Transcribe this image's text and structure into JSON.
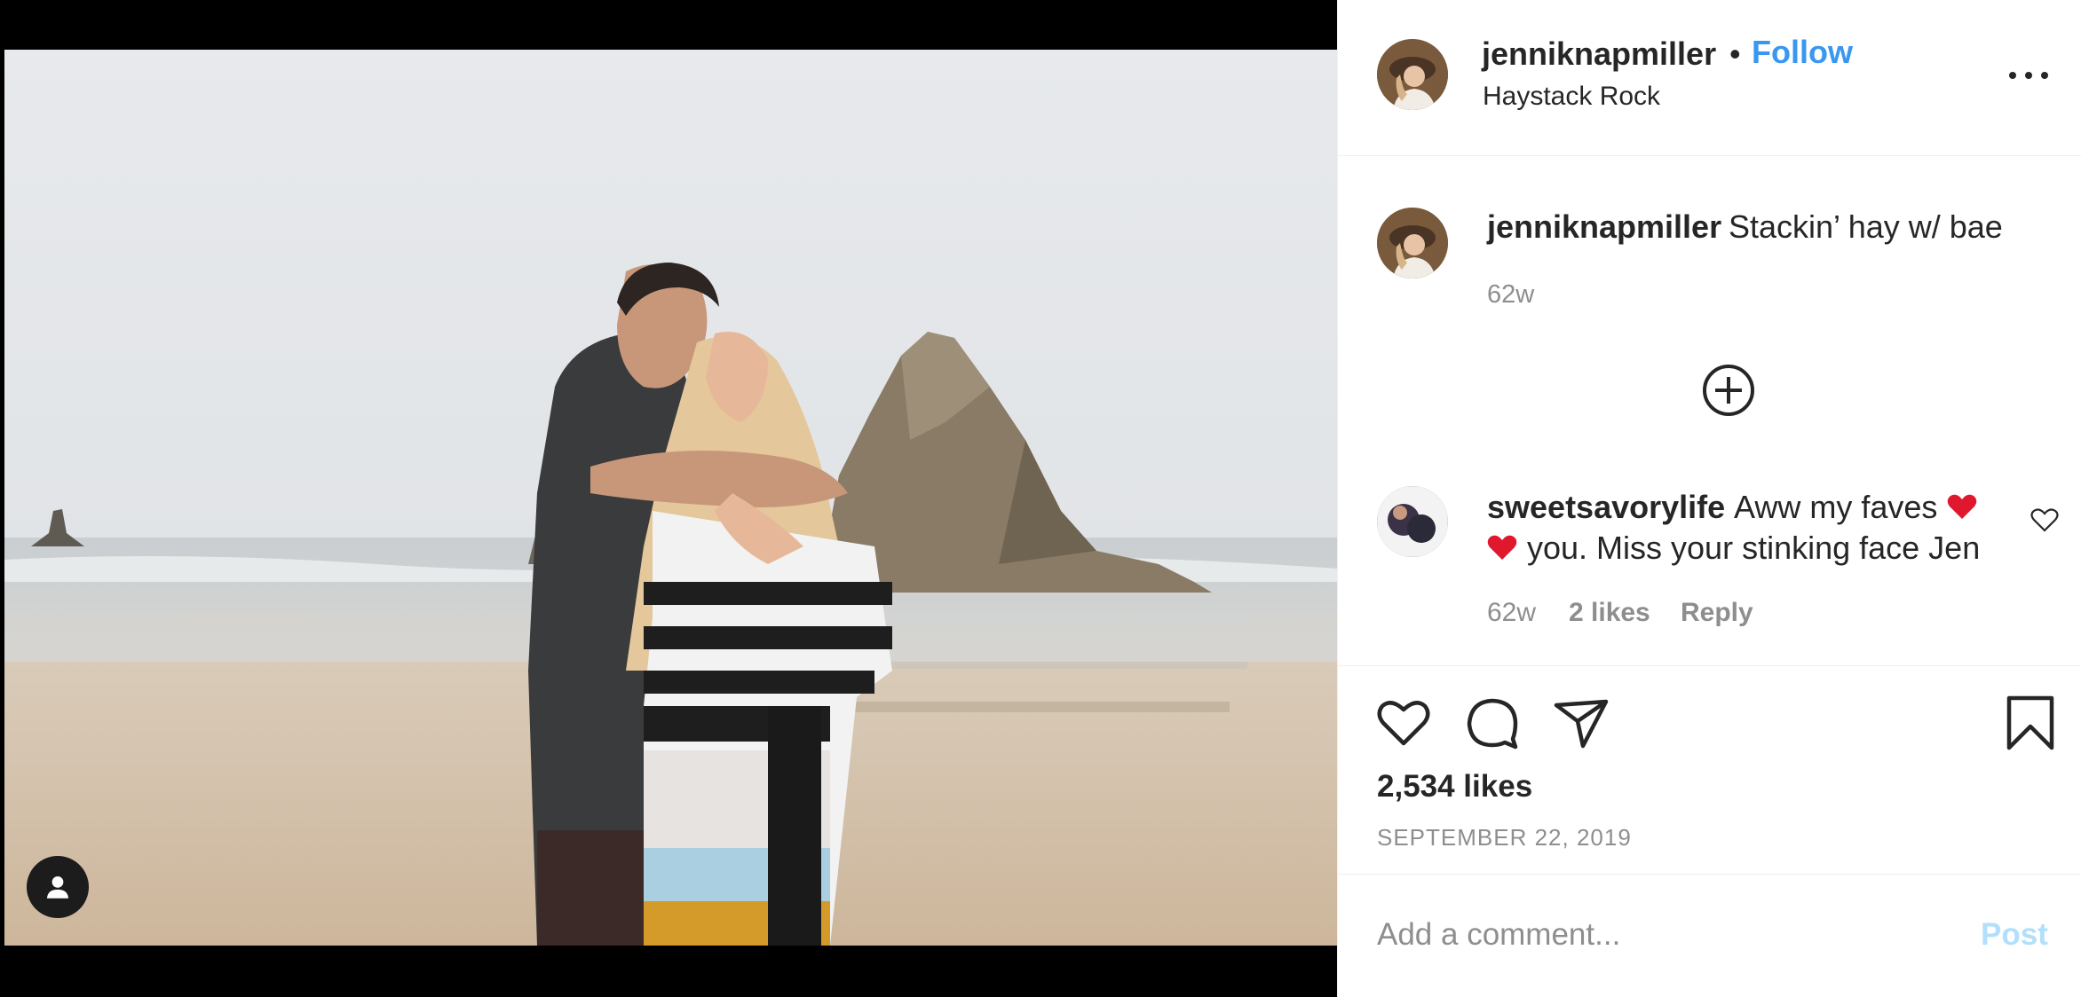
{
  "post": {
    "username": "jenniknapmiller",
    "separator": "•",
    "follow_label": "Follow",
    "location": "Haystack Rock",
    "caption_username": "jenniknapmiller",
    "caption_text": "Stackin’ hay w/ bae",
    "caption_time": "62w",
    "likes_label": "2,534 likes",
    "date": "SEPTEMBER 22, 2019"
  },
  "comment": {
    "username": "sweetsavorylife",
    "text_line1": "Aww my faves",
    "text_line2": "you. Miss your stinking face Jen",
    "time": "62w",
    "likes": "2 likes",
    "reply_label": "Reply"
  },
  "composer": {
    "placeholder": "Add a comment...",
    "post_label": "Post"
  },
  "icons": {
    "more": "more-options-icon",
    "load_more": "plus-circle-icon",
    "comment_like": "heart-outline-icon",
    "like": "heart-outline-icon",
    "comment": "speech-bubble-icon",
    "share": "paper-plane-icon",
    "save": "bookmark-icon",
    "tag": "user-tag-icon"
  },
  "colors": {
    "link_blue": "#3897f0",
    "post_disabled": "#b2dffc",
    "text": "#262626",
    "secondary_text": "#8e8e8e",
    "heart_emoji": "#e0182d"
  }
}
